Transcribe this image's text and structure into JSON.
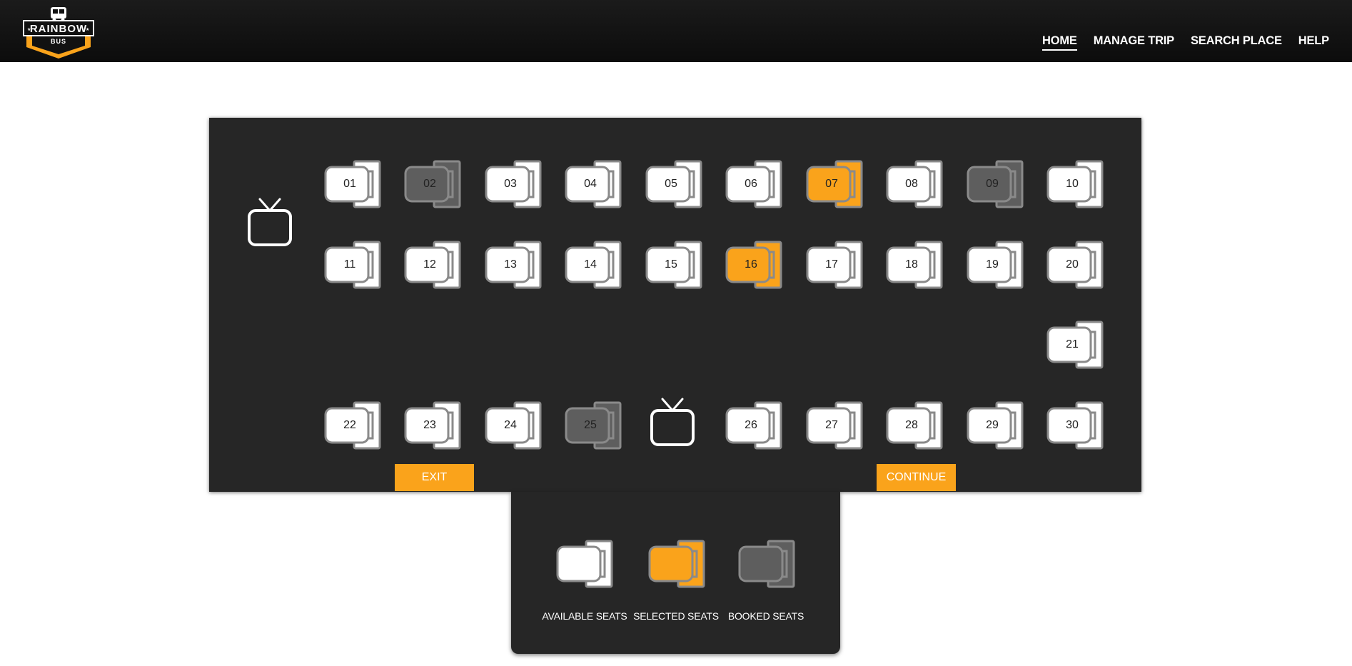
{
  "brand": {
    "name": "RAINBOW",
    "sub": "BUS",
    "accent_color": "#faa31b"
  },
  "nav": {
    "items": [
      {
        "label": "HOME",
        "active": true
      },
      {
        "label": "MANAGE TRIP",
        "active": false
      },
      {
        "label": "SEARCH PLACE",
        "active": false
      },
      {
        "label": "HELP",
        "active": false
      }
    ]
  },
  "colors": {
    "available": "#ffffff",
    "selected": "#faa31b",
    "booked": "#5e5e5e",
    "seat_border": "#8a8a8a",
    "panel": "#262626"
  },
  "screens": [
    "tv-icon",
    "tv-icon"
  ],
  "seats": [
    {
      "number": "01",
      "status": "available"
    },
    {
      "number": "02",
      "status": "booked"
    },
    {
      "number": "03",
      "status": "available"
    },
    {
      "number": "04",
      "status": "available"
    },
    {
      "number": "05",
      "status": "available"
    },
    {
      "number": "06",
      "status": "available"
    },
    {
      "number": "07",
      "status": "selected"
    },
    {
      "number": "08",
      "status": "available"
    },
    {
      "number": "09",
      "status": "booked"
    },
    {
      "number": "10",
      "status": "available"
    },
    {
      "number": "11",
      "status": "available"
    },
    {
      "number": "12",
      "status": "available"
    },
    {
      "number": "13",
      "status": "available"
    },
    {
      "number": "14",
      "status": "available"
    },
    {
      "number": "15",
      "status": "available"
    },
    {
      "number": "16",
      "status": "selected"
    },
    {
      "number": "17",
      "status": "available"
    },
    {
      "number": "18",
      "status": "available"
    },
    {
      "number": "19",
      "status": "available"
    },
    {
      "number": "20",
      "status": "available"
    },
    {
      "number": "21",
      "status": "available"
    },
    {
      "number": "22",
      "status": "available"
    },
    {
      "number": "23",
      "status": "available"
    },
    {
      "number": "24",
      "status": "available"
    },
    {
      "number": "25",
      "status": "booked"
    },
    {
      "number": "26",
      "status": "available"
    },
    {
      "number": "27",
      "status": "available"
    },
    {
      "number": "28",
      "status": "available"
    },
    {
      "number": "29",
      "status": "available"
    },
    {
      "number": "30",
      "status": "available"
    }
  ],
  "buttons": {
    "exit": "EXIT",
    "continue": "CONTINUE"
  },
  "legend": [
    {
      "status": "available",
      "label": "AVAILABLE SEATS"
    },
    {
      "status": "selected",
      "label": "SELECTED SEATS"
    },
    {
      "status": "booked",
      "label": "BOOKED SEATS"
    }
  ]
}
